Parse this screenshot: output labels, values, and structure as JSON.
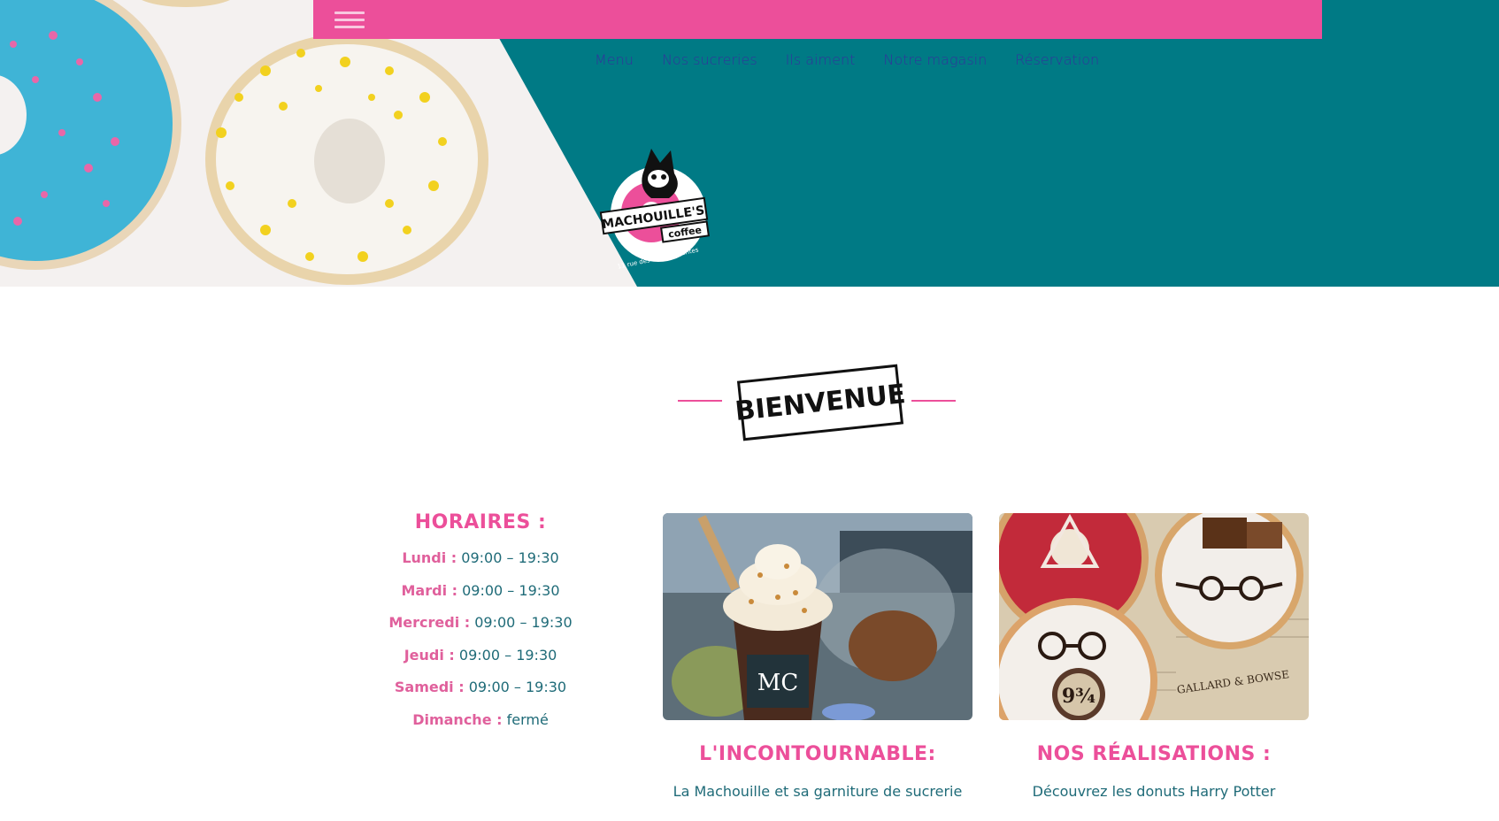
{
  "nav": {
    "items": [
      {
        "label": "Menu"
      },
      {
        "label": "Nos sucreries"
      },
      {
        "label": "Ils aiment"
      },
      {
        "label": "Notre magasin"
      },
      {
        "label": "Réservation"
      }
    ]
  },
  "logo": {
    "name": "MACHOUILLE'S",
    "sub": "coffee",
    "address": "11 rue des halles • Nantes"
  },
  "welcome": {
    "label": "BIENVENUE"
  },
  "hours": {
    "title": "HORAIRES :",
    "rows": [
      {
        "day": "Lundi :",
        "time": "09:00 – 19:30"
      },
      {
        "day": "Mardi :",
        "time": "09:00 – 19:30"
      },
      {
        "day": "Mercredi :",
        "time": "09:00 – 19:30"
      },
      {
        "day": "Jeudi :",
        "time": "09:00 – 19:30"
      },
      {
        "day": "Samedi :",
        "time": "09:00 – 19:30"
      },
      {
        "day": "Dimanche :",
        "time": "fermé"
      }
    ]
  },
  "cards": [
    {
      "title": "L'INCONTOURNABLE:",
      "desc": "La Machouille et sa garniture de sucrerie",
      "cup_text": "MC"
    },
    {
      "title": "NOS RÉALISATIONS :",
      "desc": "Découvrez les donuts Harry Potter",
      "platform": "9¾",
      "paper_text": "GALLARD & BOWSE"
    }
  ],
  "colors": {
    "accent": "#ec4f9a",
    "teal": "#007a85",
    "text": "#1f6b78"
  }
}
